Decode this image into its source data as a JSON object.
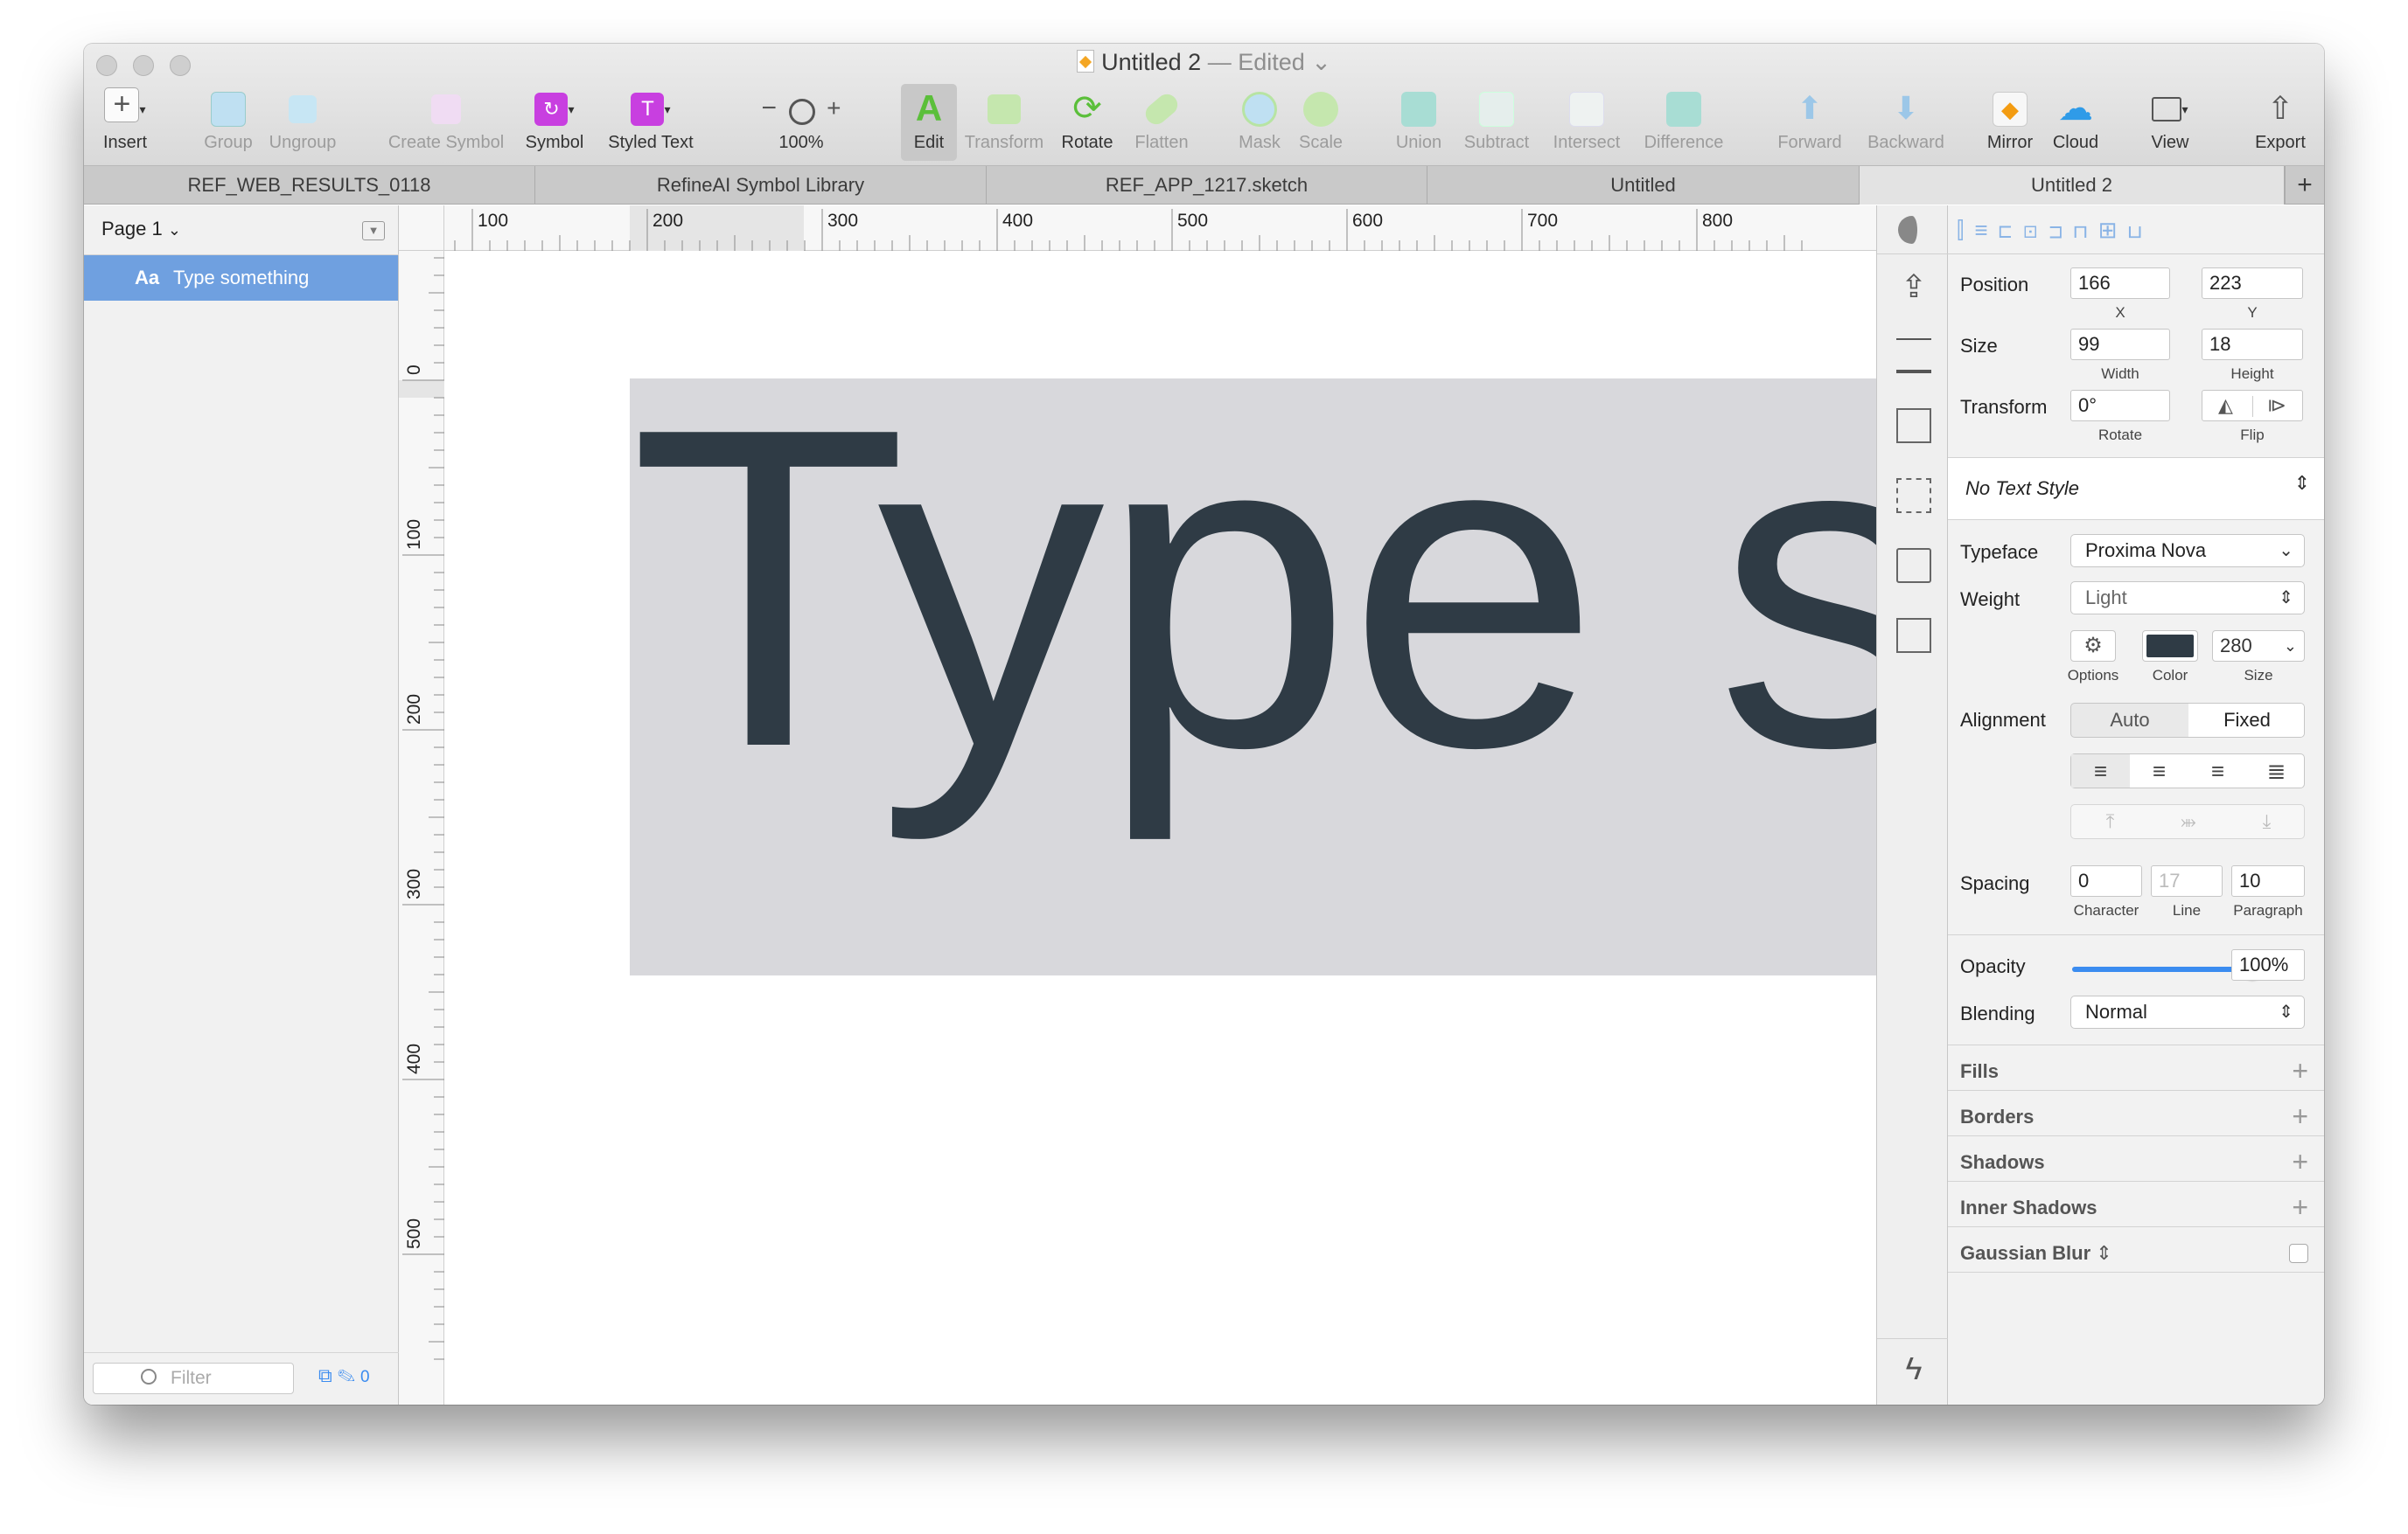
{
  "window": {
    "title": "Untitled 2",
    "edited": "— Edited"
  },
  "toolbar": {
    "insert": "Insert",
    "group": "Group",
    "ungroup": "Ungroup",
    "create_symbol": "Create Symbol",
    "symbol": "Symbol",
    "styled_text": "Styled Text",
    "zoom": "100%",
    "edit": "Edit",
    "transform": "Transform",
    "rotate": "Rotate",
    "flatten": "Flatten",
    "mask": "Mask",
    "scale": "Scale",
    "union": "Union",
    "subtract": "Subtract",
    "intersect": "Intersect",
    "difference": "Difference",
    "forward": "Forward",
    "backward": "Backward",
    "mirror": "Mirror",
    "cloud": "Cloud",
    "view": "View",
    "export": "Export"
  },
  "tabs": [
    "REF_WEB_RESULTS_0118",
    "RefineAI Symbol Library",
    "REF_APP_1217.sketch",
    "Untitled",
    "Untitled 2"
  ],
  "sidebar": {
    "page": "Page 1",
    "layer_icon": "Aa",
    "layer_name": "Type something",
    "filter_placeholder": "Filter",
    "count": "0"
  },
  "ruler": {
    "h_labels": [
      "100",
      "200",
      "300",
      "400",
      "500",
      "600",
      "700",
      "800"
    ],
    "v_labels": [
      "0",
      "100",
      "200",
      "300",
      "400",
      "500"
    ]
  },
  "canvas": {
    "text": "Type s"
  },
  "inspector": {
    "position_label": "Position",
    "x": "166",
    "y": "223",
    "x_label": "X",
    "y_label": "Y",
    "size_label": "Size",
    "width": "99",
    "height": "18",
    "width_label": "Width",
    "height_label": "Height",
    "transform_label": "Transform",
    "rotate": "0°",
    "rotate_label": "Rotate",
    "flip_label": "Flip",
    "text_style": "No Text Style",
    "typeface_label": "Typeface",
    "typeface": "Proxima Nova",
    "weight_label": "Weight",
    "weight": "Light",
    "options_label": "Options",
    "color_label": "Color",
    "size_sub_label": "Size",
    "font_size": "280",
    "alignment_label": "Alignment",
    "auto": "Auto",
    "fixed": "Fixed",
    "spacing_label": "Spacing",
    "character": "0",
    "line_placeholder": "17",
    "paragraph": "10",
    "character_label": "Character",
    "line_label": "Line",
    "paragraph_label": "Paragraph",
    "opacity_label": "Opacity",
    "opacity": "100%",
    "opacity_fraction": 1.0,
    "blending_label": "Blending",
    "blending": "Normal",
    "fills": "Fills",
    "borders": "Borders",
    "shadows": "Shadows",
    "inner_shadows": "Inner Shadows",
    "gaussian_blur": "Gaussian Blur"
  },
  "colors": {
    "text_color": "#2f3b45",
    "selection": "#6fa0e0",
    "accent": "#3b8cf0"
  }
}
